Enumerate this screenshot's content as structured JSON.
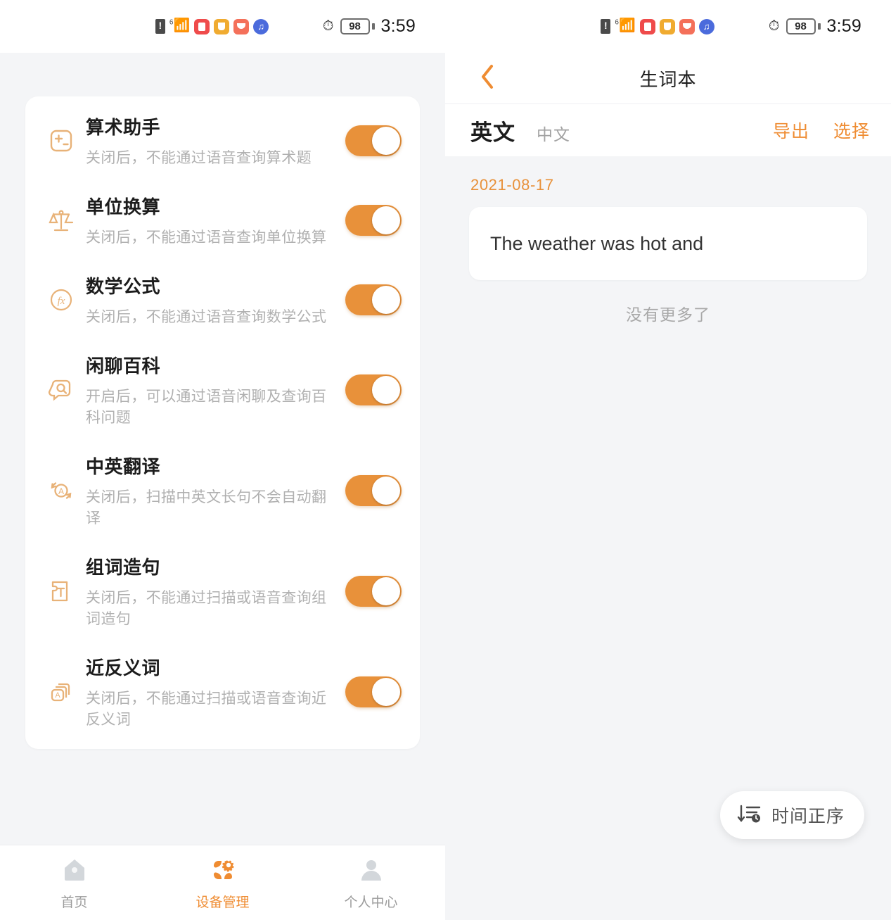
{
  "statusbar": {
    "sim_icon": "sim-alert-icon",
    "wifi_icon": "wifi-6-icon",
    "app_icons": [
      "app-red-icon",
      "app-yellow-icon",
      "app-coral-icon",
      "app-music-icon"
    ],
    "speed_icon": "speedometer-icon",
    "battery": "98",
    "time": "3:59"
  },
  "left_screen": {
    "settings": {
      "items": [
        {
          "icon": "calculator-icon",
          "title": "算术助手",
          "subtitle": "关闭后，不能通过语音查询算术题",
          "toggle_on": true
        },
        {
          "icon": "scale-icon",
          "title": "单位换算",
          "subtitle": "关闭后，不能通过语音查询单位换算",
          "toggle_on": true
        },
        {
          "icon": "fx-formula-icon",
          "title": "数学公式",
          "subtitle": "关闭后，不能通过语音查询数学公式",
          "toggle_on": true
        },
        {
          "icon": "chat-search-icon",
          "title": "闲聊百科",
          "subtitle": "开启后，可以通过语音闲聊及查询百科问题",
          "toggle_on": true
        },
        {
          "icon": "translate-icon",
          "title": "中英翻译",
          "subtitle": "关闭后，扫描中英文长句不会自动翻译",
          "toggle_on": true
        },
        {
          "icon": "word-compose-icon",
          "title": "组词造句",
          "subtitle": "关闭后，不能通过扫描或语音查询组词造句",
          "toggle_on": true
        },
        {
          "icon": "synonym-cards-icon",
          "title": "近反义词",
          "subtitle": "关闭后，不能通过扫描或语音查询近反义词",
          "toggle_on": true
        }
      ]
    },
    "tabbar": {
      "items": [
        {
          "icon": "home-icon",
          "label": "首页",
          "active": false
        },
        {
          "icon": "device-manage-icon",
          "label": "设备管理",
          "active": true
        },
        {
          "icon": "person-icon",
          "label": "个人中心",
          "active": false
        }
      ]
    }
  },
  "right_screen": {
    "navbar": {
      "back_icon": "chevron-left-icon",
      "title": "生词本"
    },
    "subbar": {
      "tabs": [
        {
          "label": "英文",
          "active": true
        },
        {
          "label": "中文",
          "active": false
        }
      ],
      "actions": [
        {
          "label": "导出"
        },
        {
          "label": "选择"
        }
      ]
    },
    "content": {
      "date": "2021-08-17",
      "entries": [
        {
          "text": "The weather was hot and"
        }
      ],
      "no_more": "没有更多了"
    },
    "sort_pill": {
      "icon": "sort-time-ascending-icon",
      "label": "时间正序"
    }
  },
  "colors": {
    "accent": "#ef8c32",
    "toggle_on": "#e8913a",
    "background": "#f4f5f7",
    "card": "#ffffff",
    "title_text": "#1c1c1c",
    "sub_text": "#b0b0b0",
    "date_text": "#e8913a"
  }
}
